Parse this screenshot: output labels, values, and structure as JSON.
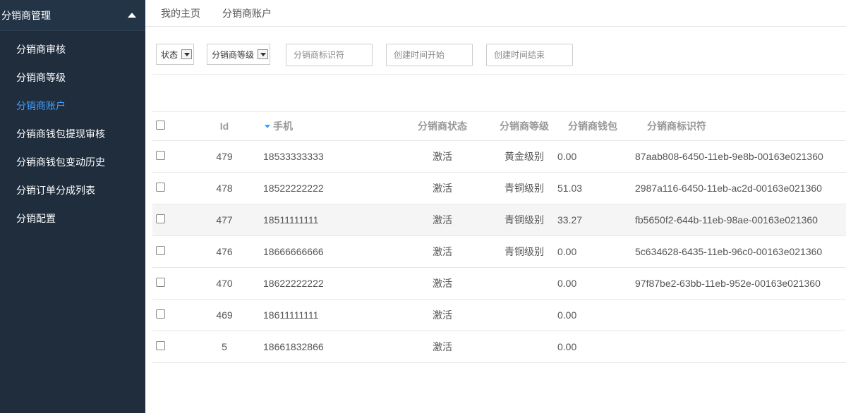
{
  "sidebar": {
    "header_title": "分销商管理",
    "items": [
      {
        "label": "分销商审核",
        "active": false
      },
      {
        "label": "分销商等级",
        "active": false
      },
      {
        "label": "分销商账户",
        "active": true
      },
      {
        "label": "分销商钱包提现审核",
        "active": false
      },
      {
        "label": "分销商钱包变动历史",
        "active": false
      },
      {
        "label": "分销订单分成列表",
        "active": false
      },
      {
        "label": "分销配置",
        "active": false
      }
    ]
  },
  "tabs": [
    {
      "label": "我的主页"
    },
    {
      "label": "分销商账户"
    }
  ],
  "filters": {
    "status_select": "状态",
    "level_select": "分销商等级",
    "identifier_placeholder": "分销商标识符",
    "created_start_placeholder": "创建时间开始",
    "created_end_placeholder": "创建时间结束"
  },
  "table": {
    "columns": {
      "id": "Id",
      "phone": "手机",
      "status": "分销商状态",
      "level": "分销商等级",
      "wallet": "分销商钱包",
      "identifier": "分销商标识符"
    },
    "sorted_column": "phone",
    "rows": [
      {
        "id": "479",
        "phone": "18533333333",
        "status": "激活",
        "level": "黄金级别",
        "wallet": "0.00",
        "identifier": "87aab808-6450-11eb-9e8b-00163e021360"
      },
      {
        "id": "478",
        "phone": "18522222222",
        "status": "激活",
        "level": "青铜级别",
        "wallet": "51.03",
        "identifier": "2987a116-6450-11eb-ac2d-00163e021360"
      },
      {
        "id": "477",
        "phone": "18511111111",
        "status": "激活",
        "level": "青铜级别",
        "wallet": "33.27",
        "identifier": "fb5650f2-644b-11eb-98ae-00163e021360"
      },
      {
        "id": "476",
        "phone": "18666666666",
        "status": "激活",
        "level": "青铜级别",
        "wallet": "0.00",
        "identifier": "5c634628-6435-11eb-96c0-00163e021360"
      },
      {
        "id": "470",
        "phone": "18622222222",
        "status": "激活",
        "level": "",
        "wallet": "0.00",
        "identifier": "97f87be2-63bb-11eb-952e-00163e021360"
      },
      {
        "id": "469",
        "phone": "18611111111",
        "status": "激活",
        "level": "",
        "wallet": "0.00",
        "identifier": ""
      },
      {
        "id": "5",
        "phone": "18661832866",
        "status": "激活",
        "level": "",
        "wallet": "0.00",
        "identifier": ""
      }
    ]
  },
  "colors": {
    "sidebar_bg": "#1f2d3d",
    "sidebar_header_bg": "#243447",
    "accent": "#409eff",
    "striped_row": "#f5f5f5"
  }
}
